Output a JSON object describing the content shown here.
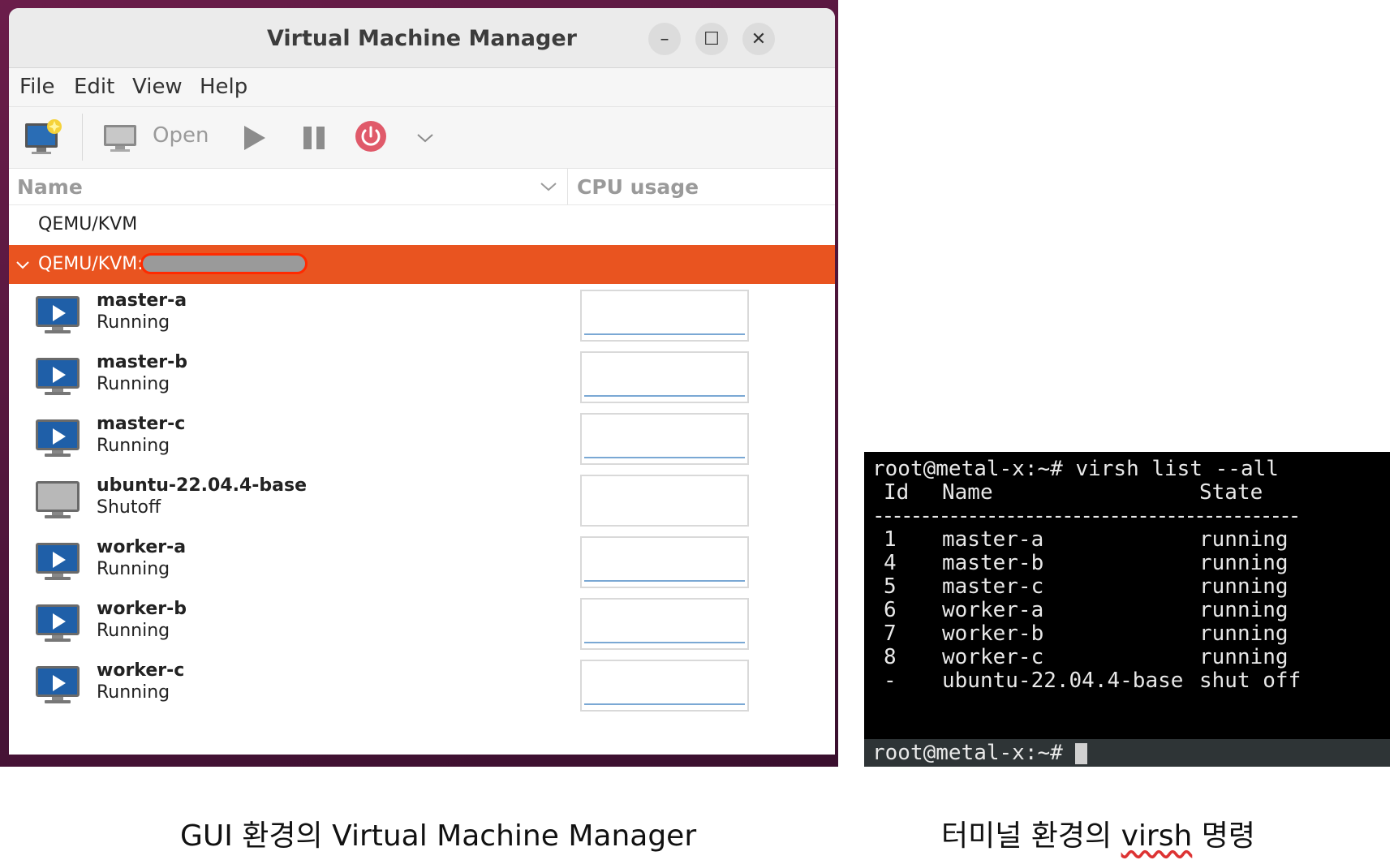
{
  "window": {
    "title": "Virtual Machine Manager",
    "controls": {
      "minimize": "–",
      "maximize": "☐",
      "close": "✕"
    }
  },
  "menu": [
    "File",
    "Edit",
    "View",
    "Help"
  ],
  "toolbar": {
    "open_label": "Open",
    "icons": [
      "new-vm-icon",
      "monitor-icon",
      "play-icon",
      "pause-icon",
      "power-icon",
      "chevron-down-icon"
    ]
  },
  "columns": {
    "name": "Name",
    "cpu": "CPU usage"
  },
  "connections": [
    {
      "label": "QEMU/KVM"
    },
    {
      "label": "QEMU/KVM:",
      "selected": true,
      "host_redacted": true
    }
  ],
  "vms": [
    {
      "name": "master-a",
      "status": "Running"
    },
    {
      "name": "master-b",
      "status": "Running"
    },
    {
      "name": "master-c",
      "status": "Running"
    },
    {
      "name": "ubuntu-22.04.4-base",
      "status": "Shutoff"
    },
    {
      "name": "worker-a",
      "status": "Running"
    },
    {
      "name": "worker-b",
      "status": "Running"
    },
    {
      "name": "worker-c",
      "status": "Running"
    }
  ],
  "terminal": {
    "prompt": "root@metal-x:~#",
    "command": "root@metal-x:~# virsh list --all",
    "headers": [
      "Id",
      "Name",
      "State"
    ],
    "separator": "---------------------------------------------",
    "rows": [
      {
        "id": "1",
        "name": "master-a",
        "state": "running"
      },
      {
        "id": "4",
        "name": "master-b",
        "state": "running"
      },
      {
        "id": "5",
        "name": "master-c",
        "state": "running"
      },
      {
        "id": "6",
        "name": "worker-a",
        "state": "running"
      },
      {
        "id": "7",
        "name": "worker-b",
        "state": "running"
      },
      {
        "id": "8",
        "name": "worker-c",
        "state": "running"
      },
      {
        "id": "-",
        "name": "ubuntu-22.04.4-base",
        "state": "shut off"
      }
    ]
  },
  "captions": {
    "left": "GUI 환경의 Virtual Machine Manager",
    "right_prefix": "터미널 환경의 ",
    "right_cmd": "virsh",
    "right_suffix": " 명령"
  },
  "colors": {
    "accent": "#e95420",
    "frame": "#5a1840",
    "power": "#e05a6a",
    "cpu_line": "#7aa8d4"
  }
}
